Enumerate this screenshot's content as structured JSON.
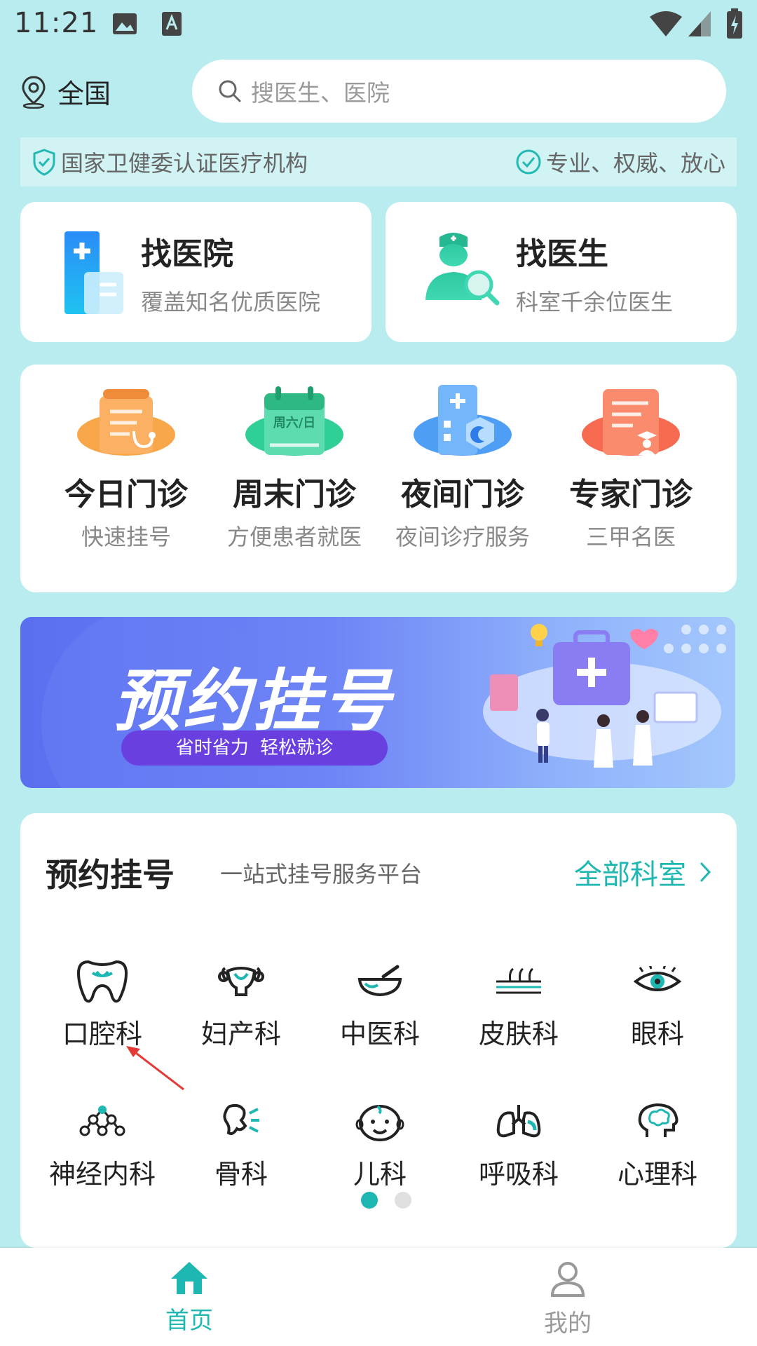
{
  "status_bar": {
    "time": "11:21"
  },
  "location": {
    "label": "全国"
  },
  "search": {
    "placeholder": "搜医生、医院"
  },
  "certification": {
    "left_text": "国家卫健委认证医疗机构",
    "right_text": "专业、权威、放心"
  },
  "quick_entries": [
    {
      "title": "找医院",
      "subtitle": "覆盖知名优质医院"
    },
    {
      "title": "找医生",
      "subtitle": "科室千余位医生"
    }
  ],
  "services": [
    {
      "title": "今日门诊",
      "subtitle": "快速挂号"
    },
    {
      "title": "周末门诊",
      "subtitle": "方便患者就医",
      "icon_text": "周六/日"
    },
    {
      "title": "夜间门诊",
      "subtitle": "夜间诊疗服务"
    },
    {
      "title": "专家门诊",
      "subtitle": "三甲名医"
    }
  ],
  "banner": {
    "title": "预约挂号",
    "tagline": "省时省力  轻松就诊"
  },
  "departments": {
    "title": "预约挂号",
    "subtitle": "一站式挂号服务平台",
    "all_link": "全部科室",
    "items": [
      {
        "label": "口腔科",
        "icon": "tooth-icon"
      },
      {
        "label": "妇产科",
        "icon": "uterus-icon"
      },
      {
        "label": "中医科",
        "icon": "mortar-icon"
      },
      {
        "label": "皮肤科",
        "icon": "skin-icon"
      },
      {
        "label": "眼科",
        "icon": "eye-icon"
      },
      {
        "label": "神经内科",
        "icon": "neuron-icon"
      },
      {
        "label": "骨科",
        "icon": "bone-icon"
      },
      {
        "label": "儿科",
        "icon": "baby-face-icon"
      },
      {
        "label": "呼吸科",
        "icon": "lungs-icon"
      },
      {
        "label": "心理科",
        "icon": "brain-head-icon"
      }
    ],
    "page_indicator": {
      "current": 1,
      "total": 2
    }
  },
  "tab_bar": [
    {
      "label": "首页",
      "active": true
    },
    {
      "label": "我的",
      "active": false
    }
  ],
  "colors": {
    "accent": "#1fb7b2",
    "background": "#b8ecee"
  }
}
